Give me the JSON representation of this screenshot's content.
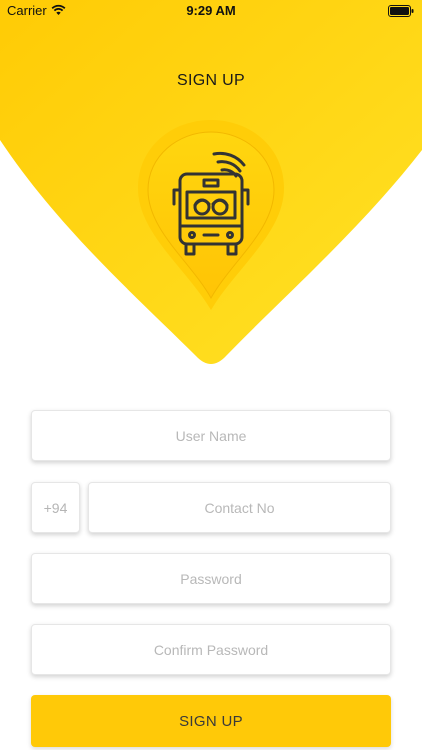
{
  "status_bar": {
    "carrier": "Carrier",
    "time": "9:29 AM"
  },
  "header": {
    "title": "SIGN UP"
  },
  "logo": {
    "icon": "school-bus-pin-icon"
  },
  "form": {
    "username_placeholder": "User Name",
    "country_code": "+94",
    "contact_placeholder": "Contact No",
    "password_placeholder": "Password",
    "confirm_password_placeholder": "Confirm Password"
  },
  "actions": {
    "signup_label": "SIGN UP"
  },
  "colors": {
    "accent": "#ffc908",
    "accent_light": "#ffe026",
    "background": "#ffffff"
  }
}
